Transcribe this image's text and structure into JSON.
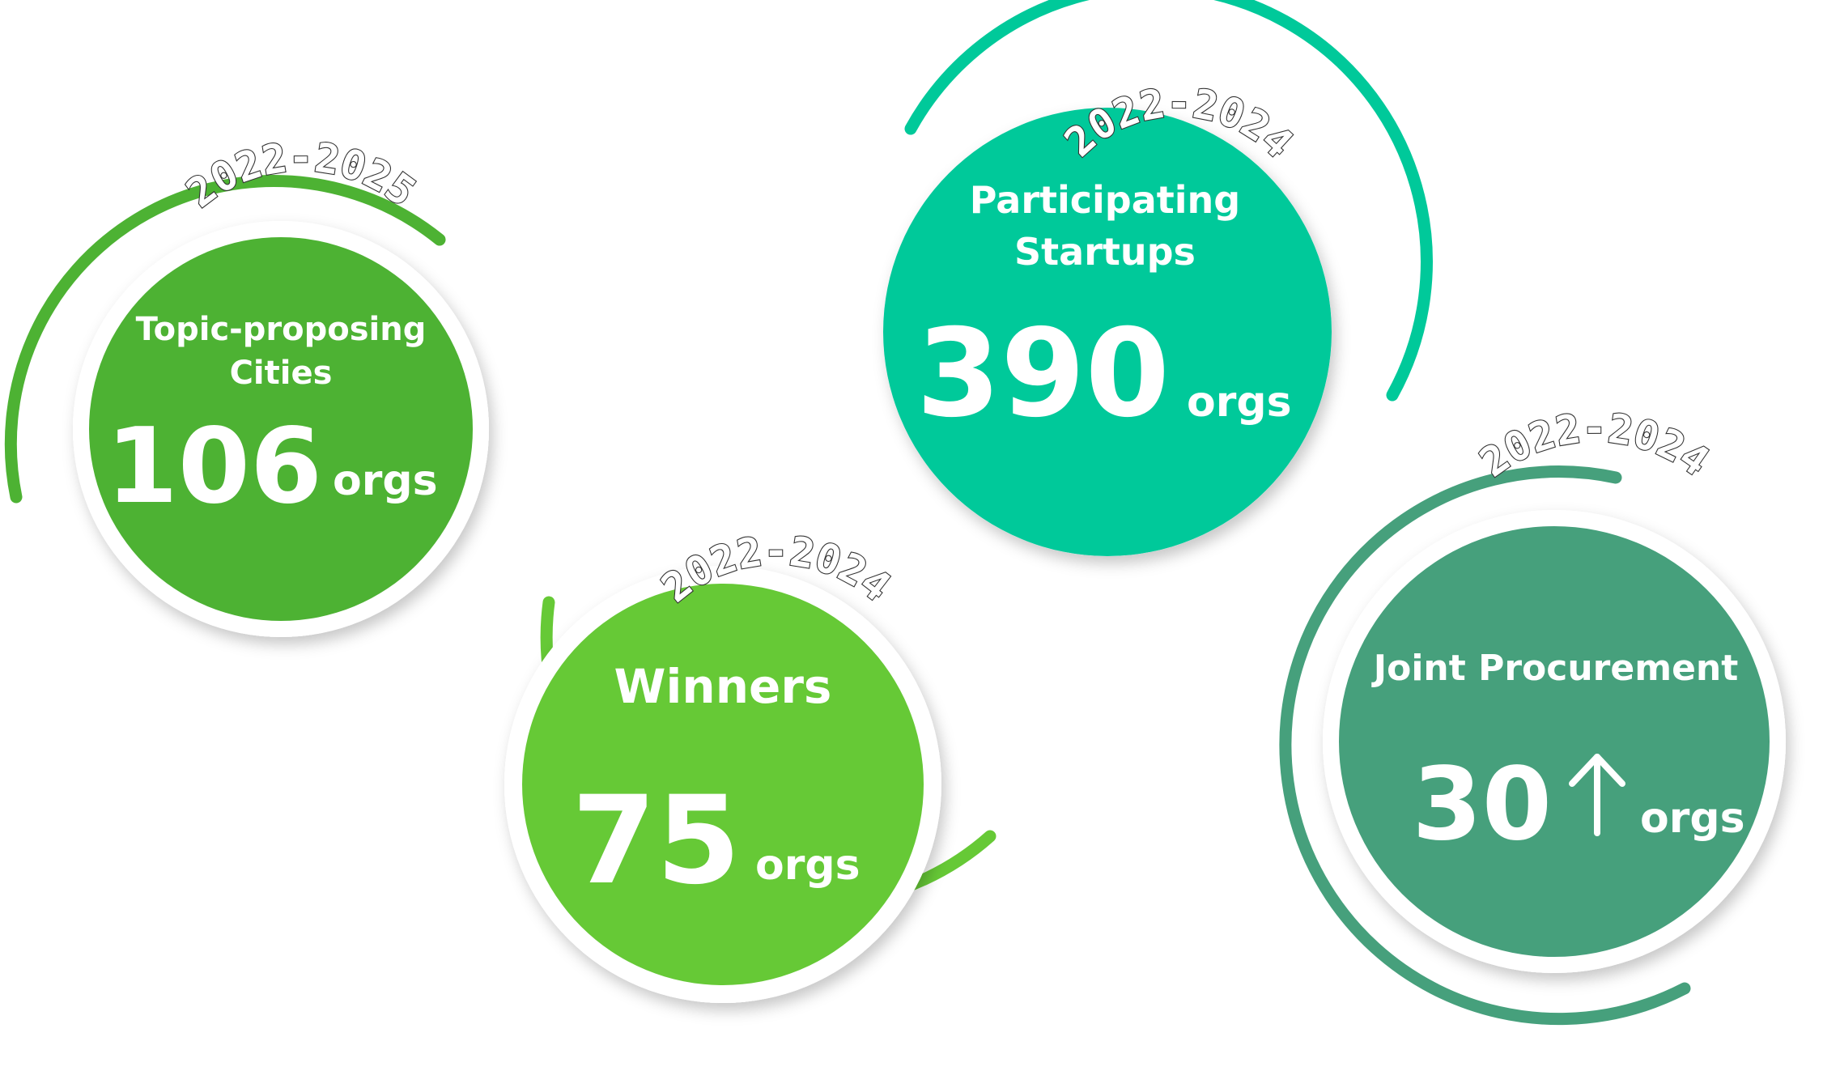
{
  "stats": [
    {
      "id": "cities",
      "label_lines": [
        "Topic-proposing",
        "Cities"
      ],
      "value": "106",
      "arrow": false,
      "unit": "orgs",
      "years": "2022-2025",
      "color": "#4db233"
    },
    {
      "id": "startups",
      "label_lines": [
        "Participating",
        "Startups"
      ],
      "value": "390",
      "arrow": false,
      "unit": "orgs",
      "years": "2022-2024",
      "color": "#00c99a"
    },
    {
      "id": "winners",
      "label_lines": [
        "Winners"
      ],
      "value": "75",
      "arrow": false,
      "unit": "orgs",
      "years": "2022-2024",
      "color": "#66c936"
    },
    {
      "id": "joint",
      "label_lines": [
        "Joint Procurement"
      ],
      "value": "30",
      "arrow": true,
      "unit": "orgs",
      "years": "2022-2024",
      "color": "#46a07c"
    }
  ],
  "icons": {
    "increase": "arrow-up-icon"
  }
}
